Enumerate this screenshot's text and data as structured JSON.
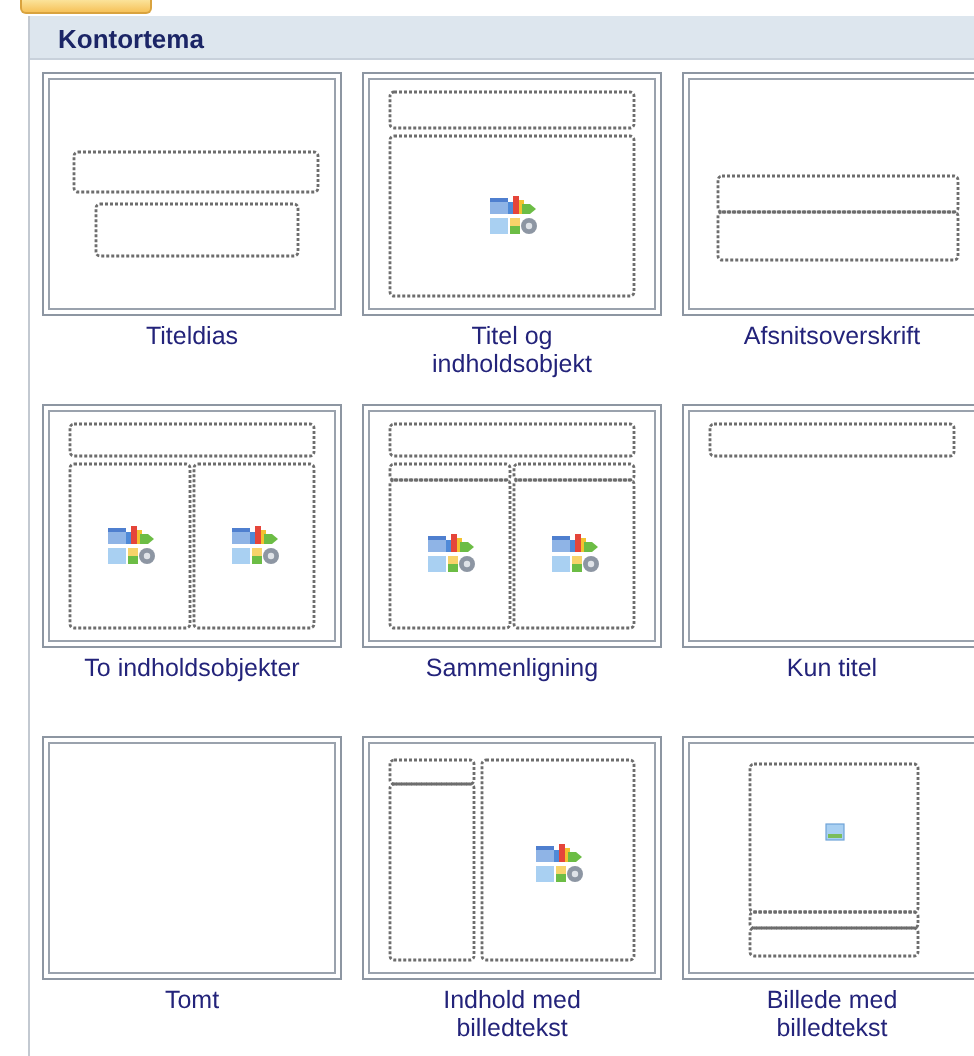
{
  "gallery": {
    "title": "Kontortema",
    "layouts": [
      {
        "kind": "title",
        "label": "Titeldias"
      },
      {
        "kind": "title-content",
        "label": "Titel og\nindholdsobjekt"
      },
      {
        "kind": "section",
        "label": "Afsnitsoverskrift"
      },
      {
        "kind": "two-content",
        "label": "To indholdsobjekter"
      },
      {
        "kind": "comparison",
        "label": "Sammenligning"
      },
      {
        "kind": "title-only",
        "label": "Kun titel"
      },
      {
        "kind": "blank",
        "label": "Tomt"
      },
      {
        "kind": "content-caption",
        "label": "Indhold med\nbilledtekst"
      },
      {
        "kind": "picture-caption",
        "label": "Billede med\nbilledtekst"
      }
    ]
  }
}
